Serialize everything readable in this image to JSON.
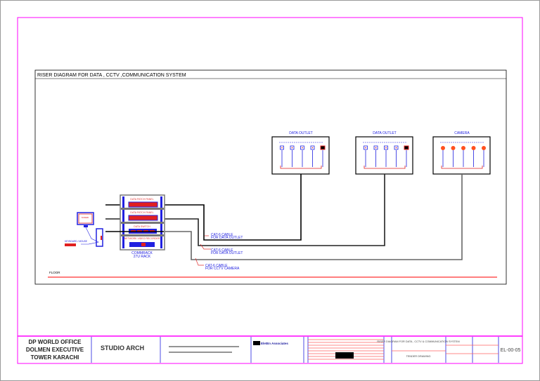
{
  "diagram": {
    "title": "RISER DIAGRAM FOR DATA , CCTV ,COMMUNICATION SYSTEM",
    "groups": [
      {
        "label": "DATA OUTLET",
        "kind": "data"
      },
      {
        "label": "DATA OUTLET",
        "kind": "data"
      },
      {
        "label": "CAMERA",
        "kind": "camera"
      }
    ],
    "rack": {
      "patch_panel_1": "DATA PATCH PANEL",
      "patch_panel_2": "DATA PATCH PANEL",
      "switch": "DATA SWITCH",
      "nvr": "NETWORK VIDEO RECORDER",
      "label_line1": "COMMRACK",
      "label_line2": "27U RACK"
    },
    "workstation": {
      "screen": "SCREEN",
      "keyboard": "KEYBOARD / MOUSE"
    },
    "cables": [
      {
        "line1": "CAT-6 CABLE",
        "line2": "FOR DATA OUTLET"
      },
      {
        "line1": "CAT-6 CABLE",
        "line2": "FOR DATA OUTLET"
      },
      {
        "line1": "CAT-6 CABLE",
        "line2": "FOR CCTV CAMERA"
      }
    ],
    "floor": "FLOOR",
    "colors": {
      "frame": "#ff00ff",
      "wire": "#000000",
      "device": "#2020e0",
      "accent": "#ff2020"
    }
  },
  "title_block": {
    "project": [
      "DP WORLD OFFICE",
      "DOLMEN EXECUTIVE",
      "TOWER KARACHI"
    ],
    "architect": "STUDIO ARCH",
    "consultant": "EletEn Associates",
    "drawing_title": "RISER DIAGRAM FOR DATA , CCTV & COMMUNICATION SYSTEM",
    "status": "TENDER DRAWING",
    "drawing_no": "EL-00-05"
  }
}
